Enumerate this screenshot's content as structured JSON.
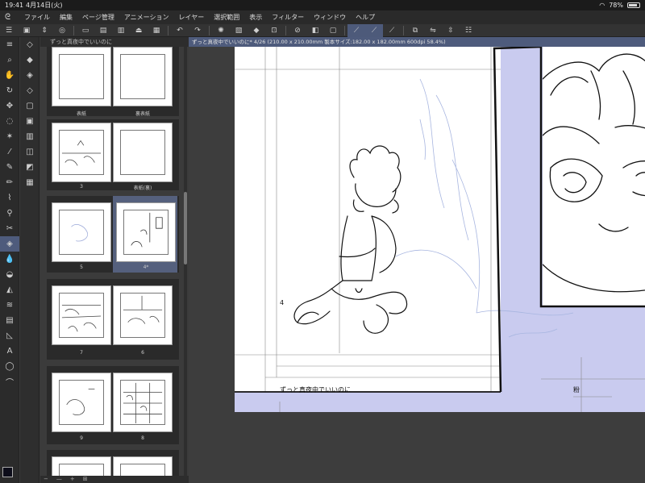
{
  "status": {
    "time": "19:41",
    "date": "4月14日(火)",
    "battery": "78%"
  },
  "menu": {
    "items": [
      "ファイル",
      "編集",
      "ページ管理",
      "アニメーション",
      "レイヤー",
      "選択範囲",
      "表示",
      "フィルター",
      "ウィンドウ",
      "ヘルプ"
    ]
  },
  "panel": {
    "tab_title": "ずっと真夜中でいいのに",
    "pages": [
      {
        "left": "表紙",
        "right": "裏表紙"
      },
      {
        "left": "3",
        "right": "表紙(裏)"
      },
      {
        "left": "5",
        "right": "4*"
      },
      {
        "left": "7",
        "right": "6"
      },
      {
        "left": "9",
        "right": "8"
      }
    ]
  },
  "canvas": {
    "tab_title": "ずっと真夜中でいいのに* 4/26 (210.00 x 210.00mm 製本サイズ:182.00 x 182.00mm 600dpi 58.4%)",
    "page_number": "4",
    "footer_title": "ずっと真夜中でいいのに",
    "right_mark": "粉"
  },
  "colors": {
    "accent": "#4e5b7c",
    "bleed": "#c9cbef",
    "main_color": "#0d0d1a"
  }
}
